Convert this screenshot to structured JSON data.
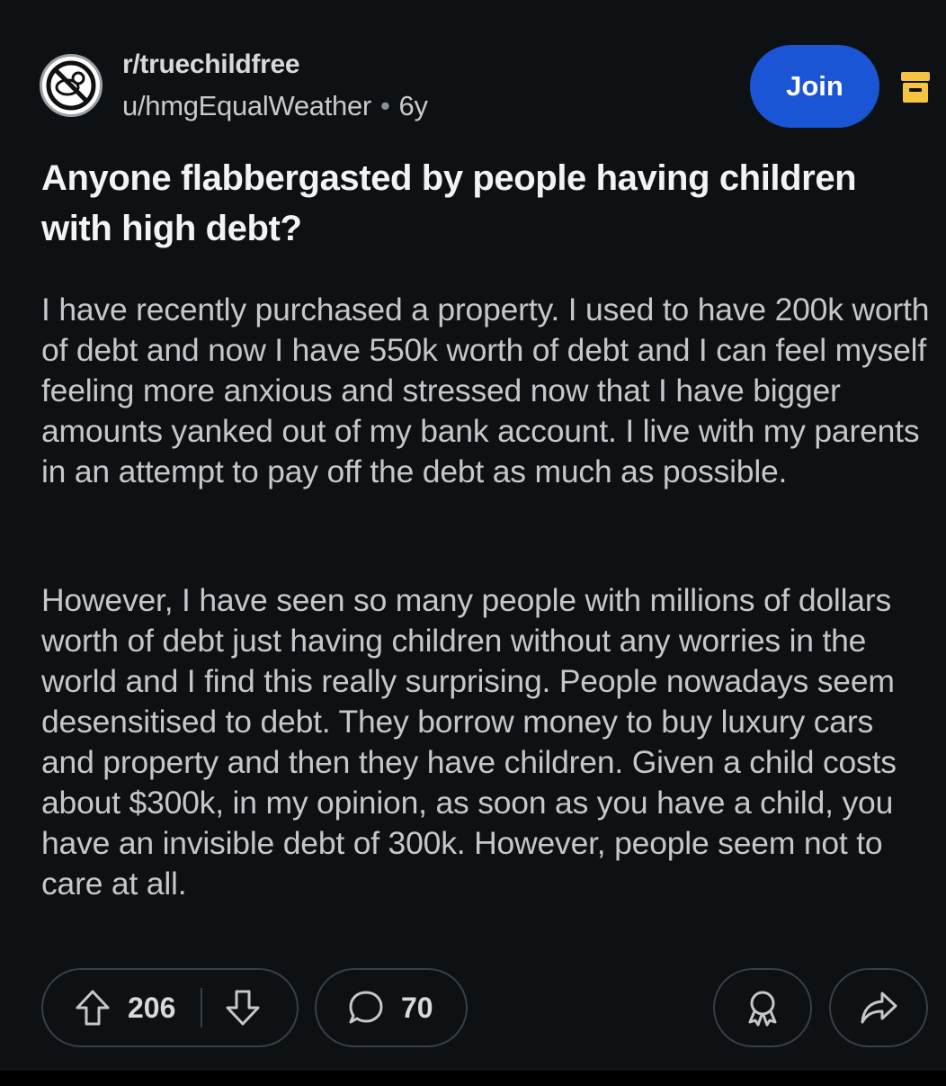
{
  "post": {
    "subreddit": "r/truechildfree",
    "username": "u/hmgEqualWeather",
    "separator": "•",
    "age": "6y",
    "join_label": "Join",
    "title": "Anyone flabbergasted by people having children with high debt?",
    "body": [
      "I have recently purchased a property. I used to have 200k worth of debt and now I have 550k worth of debt and I can feel myself feeling more anxious and stressed now that I have bigger amounts yanked out of my bank account. I live with my parents in an attempt to pay off the debt as much as possible.",
      "However, I have seen so many people with millions of dollars worth of debt just having children without any worries in the world and I find this really surprising. People nowadays seem desensitised to debt. They borrow money to buy luxury cars and property and then they have children. Given a child costs about $300k, in my opinion, as soon as you have a child, you have an invisible debt of 300k. However, people seem not to care at all."
    ],
    "upvotes": "206",
    "comments": "70"
  },
  "icons": {
    "avatar": "no-baby-icon",
    "archive": "archive-icon",
    "upvote": "upvote-arrow-icon",
    "downvote": "downvote-arrow-icon",
    "comment": "comment-bubble-icon",
    "award": "award-icon",
    "share": "share-arrow-icon"
  },
  "colors": {
    "background": "#0e1113",
    "join_button": "#1a55d6",
    "archive_icon": "#f5c542"
  }
}
